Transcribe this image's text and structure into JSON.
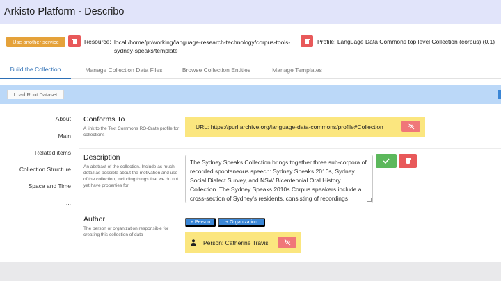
{
  "app": {
    "title": "Arkisto Platform - Describo"
  },
  "resource_bar": {
    "use_service_label": "Use another service",
    "resource_label": "Resource:",
    "resource_path": "local:/home/pt/working/language-research-technology/corpus-tools-sydney-speaks/template",
    "profile_label": "Profile: Language Data Commons top level Collection (corpus) (0.1)"
  },
  "tabs": [
    {
      "label": "Build the Collection",
      "active": true
    },
    {
      "label": "Manage Collection Data Files",
      "active": false
    },
    {
      "label": "Browse Collection Entities",
      "active": false
    },
    {
      "label": "Manage Templates",
      "active": false
    }
  ],
  "toolbar": {
    "load_root_label": "Load Root Dataset"
  },
  "sidebar": {
    "items": [
      {
        "label": "About"
      },
      {
        "label": "Main"
      },
      {
        "label": "Related items"
      },
      {
        "label": "Collection Structure"
      },
      {
        "label": "Space and Time"
      },
      {
        "label": "..."
      }
    ]
  },
  "fields": {
    "conforms_to": {
      "title": "Conforms To",
      "help": "A link to the Text Commons RO-Crate profile for collections",
      "value": "URL: https://purl.archive.org/language-data-commons/profile#Collection"
    },
    "description": {
      "title": "Description",
      "help": "An abstract of the collection. Include as much detail as possible about the motivation and use of the collection, including things that we do not yet have properties for",
      "value": "The Sydney Speaks Collection brings together three sub-corpora of recorded spontaneous speech: Sydney Speaks 2010s, Sydney Social Dialect Survey, and NSW Bicentennial Oral History Collection. The Sydney Speaks 2010s Corpus speakers include a cross-section of Sydney's residents, consisting of recordings"
    },
    "author": {
      "title": "Author",
      "help": "The person or organization responsible for creating this collection of data",
      "add_person_label": "+ Person",
      "add_org_label": "+ Organization",
      "value": "Person: Catherine Travis"
    }
  },
  "colors": {
    "header_bg": "#e1e4fa",
    "accent_blue": "#2d6fb5",
    "toolbar_bg": "#bbd8f8",
    "orange": "#e5a23a",
    "danger": "#e8595a",
    "success": "#5cb85c",
    "highlight": "#fbe67f"
  },
  "icons": {
    "trash": "trash-icon",
    "unlink": "unlink-icon",
    "check": "check-icon",
    "user": "user-icon"
  }
}
